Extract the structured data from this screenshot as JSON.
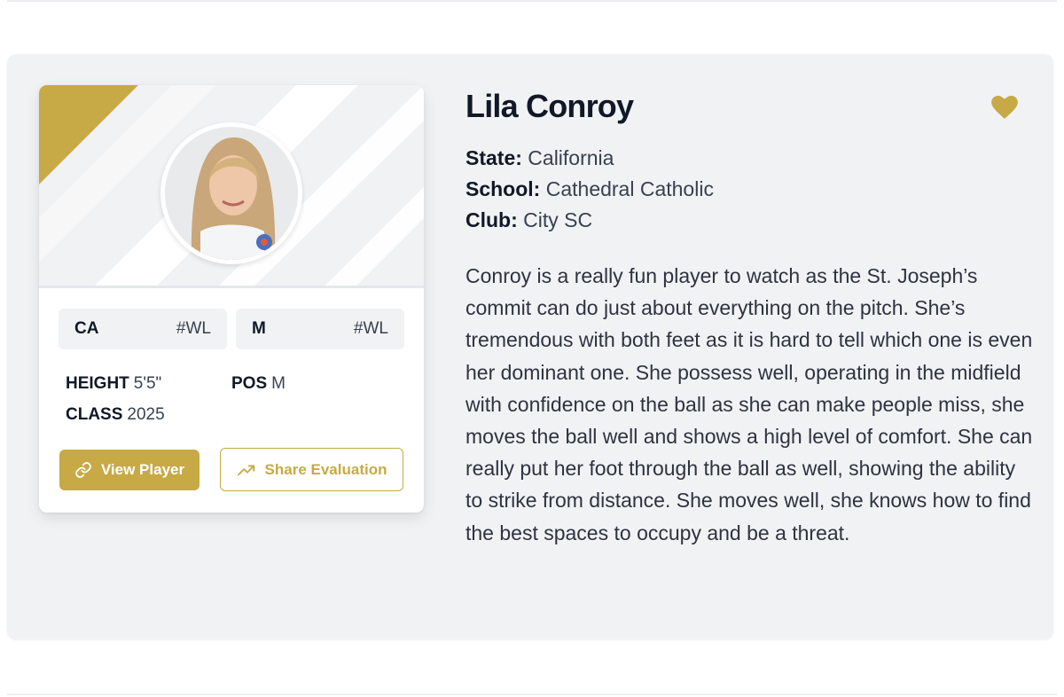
{
  "player": {
    "name": "Lila Conroy",
    "state_label": "State:",
    "state": "California",
    "school_label": "School:",
    "school": "Cathedral Catholic",
    "club_label": "Club:",
    "club": "City SC",
    "bio": "Conroy is a really fun player to watch as the St. Joseph’s commit can do just about everything on the pitch. She’s tremendous with both feet as it is hard to tell which one is even her dominant one. She possess well, operating in the midfield with confidence on the ball as she can make people miss, she moves the ball well and shows a high level of comfort. She can really put her foot through the ball as well, showing the ability to strike from distance. She moves well, she knows how to find the best spaces to occupy and be a threat."
  },
  "card": {
    "tags": [
      {
        "code": "CA",
        "rank": "#WL"
      },
      {
        "code": "M",
        "rank": "#WL"
      }
    ],
    "height_label": "HEIGHT",
    "height": "5'5\"",
    "pos_label": "POS",
    "pos": "M",
    "class_label": "CLASS",
    "class": "2025",
    "view_button": "View Player",
    "share_button": "Share Evaluation"
  },
  "icons": {
    "favorite": "heart-icon",
    "view": "link-icon",
    "share": "trending-up-icon"
  },
  "colors": {
    "accent": "#c7aa45",
    "panel": "#f1f2f4",
    "heading": "#111827"
  }
}
